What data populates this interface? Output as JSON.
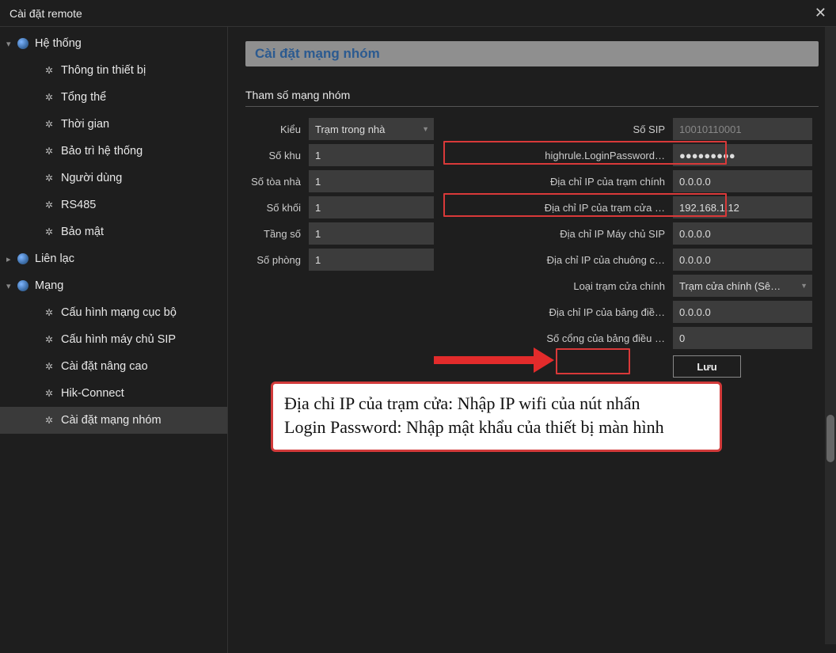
{
  "window": {
    "title": "Cài đặt remote"
  },
  "sidebar": {
    "system": {
      "label": "Hệ thống",
      "items": [
        {
          "label": "Thông tin thiết bị"
        },
        {
          "label": "Tổng thể"
        },
        {
          "label": "Thời gian"
        },
        {
          "label": "Bảo trì hệ thống"
        },
        {
          "label": "Người dùng"
        },
        {
          "label": "RS485"
        },
        {
          "label": "Bảo mật"
        }
      ]
    },
    "contact": {
      "label": "Liên lạc"
    },
    "network": {
      "label": "Mạng",
      "items": [
        {
          "label": "Cấu hình mạng cục bộ"
        },
        {
          "label": "Cấu hình máy chủ SIP"
        },
        {
          "label": "Cài đặt nâng cao"
        },
        {
          "label": "Hik-Connect"
        },
        {
          "label": "Cài đặt mạng nhóm"
        }
      ]
    }
  },
  "page": {
    "header": "Cài đặt mạng nhóm",
    "section": "Tham số mạng nhóm",
    "left": [
      {
        "label": "Kiểu",
        "value": "Trạm trong nhà",
        "type": "select"
      },
      {
        "label": "Số khu",
        "value": "1"
      },
      {
        "label": "Số tòa nhà",
        "value": "1"
      },
      {
        "label": "Số khối",
        "value": "1"
      },
      {
        "label": "Tầng số",
        "value": "1"
      },
      {
        "label": "Số phòng",
        "value": "1"
      }
    ],
    "right": [
      {
        "label": "Số SIP",
        "value": "10010110001",
        "disabled": true
      },
      {
        "label": "highrule.LoginPassword…",
        "value": "●●●●●●●●●",
        "password": true
      },
      {
        "label": "Địa chỉ IP của trạm chính",
        "value": "0.0.0.0"
      },
      {
        "label": "Địa chỉ IP của trạm cửa …",
        "value": "192.168.1.12"
      },
      {
        "label": "Địa chỉ IP Máy chủ SIP",
        "value": "0.0.0.0"
      },
      {
        "label": "Địa chỉ IP của chuông c…",
        "value": "0.0.0.0"
      },
      {
        "label": "Loại trạm cửa chính",
        "value": "Trạm cửa chính (Sê…",
        "type": "select"
      },
      {
        "label": "Địa chỉ IP của bảng điề…",
        "value": "0.0.0.0"
      },
      {
        "label": "Số cổng của bảng điều …",
        "value": "0"
      }
    ],
    "save_label": "Lưu"
  },
  "note": {
    "line1": "Địa chỉ IP của trạm cửa: Nhập IP wifi của nút nhấn",
    "line2": "Login Password: Nhập mật khẩu của thiết bị màn hình"
  }
}
